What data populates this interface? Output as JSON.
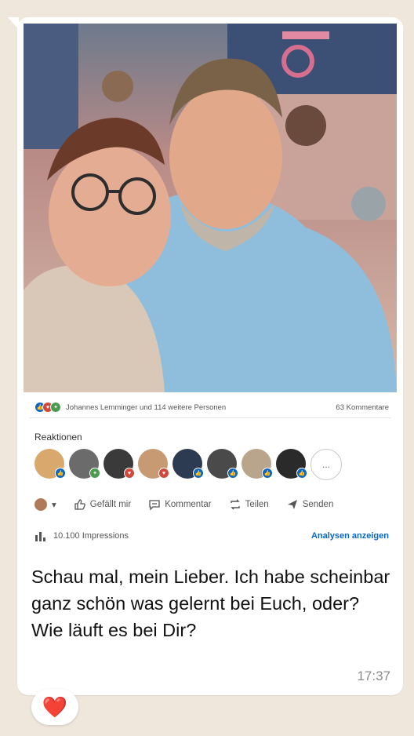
{
  "post": {
    "reaction_summary": "Johannes Lemminger und 114 weitere Personen",
    "comments_count": "63 Kommentare",
    "reactions_label": "Reaktionen",
    "reactor_avatars": [
      {
        "name": "avatar-1",
        "color": "#d9a86c",
        "badge": "like"
      },
      {
        "name": "avatar-2",
        "color": "#6b6b6b",
        "badge": "celebrate"
      },
      {
        "name": "avatar-3",
        "color": "#3a3a3a",
        "badge": "love"
      },
      {
        "name": "avatar-4",
        "color": "#c79a74",
        "badge": "love"
      },
      {
        "name": "avatar-5",
        "color": "#2c3a52",
        "badge": "like"
      },
      {
        "name": "avatar-6",
        "color": "#4a4a4a",
        "badge": "like"
      },
      {
        "name": "avatar-7",
        "color": "#b9a58c",
        "badge": "like"
      },
      {
        "name": "avatar-8",
        "color": "#2a2a2a",
        "badge": "like"
      }
    ],
    "more_reactors": "...",
    "actions": {
      "like": "Gefällt mir",
      "comment": "Kommentar",
      "share": "Teilen",
      "send": "Senden"
    },
    "impressions": "10.100 Impressions",
    "analytics_link": "Analysen anzeigen"
  },
  "message": {
    "text": "Schau mal, mein Lieber. Ich habe scheinbar ganz schön was gelernt bei Euch, oder? Wie läuft es bei Dir?",
    "time": "17:37"
  },
  "reaction_emoji": "❤️",
  "colors": {
    "wallpaper": "#efe7dc",
    "bubble": "#ffffff",
    "link": "#0a66c2",
    "like_badge": "#0a66c2",
    "love_badge": "#d0493c",
    "celebrate_badge": "#4a9b4f"
  }
}
